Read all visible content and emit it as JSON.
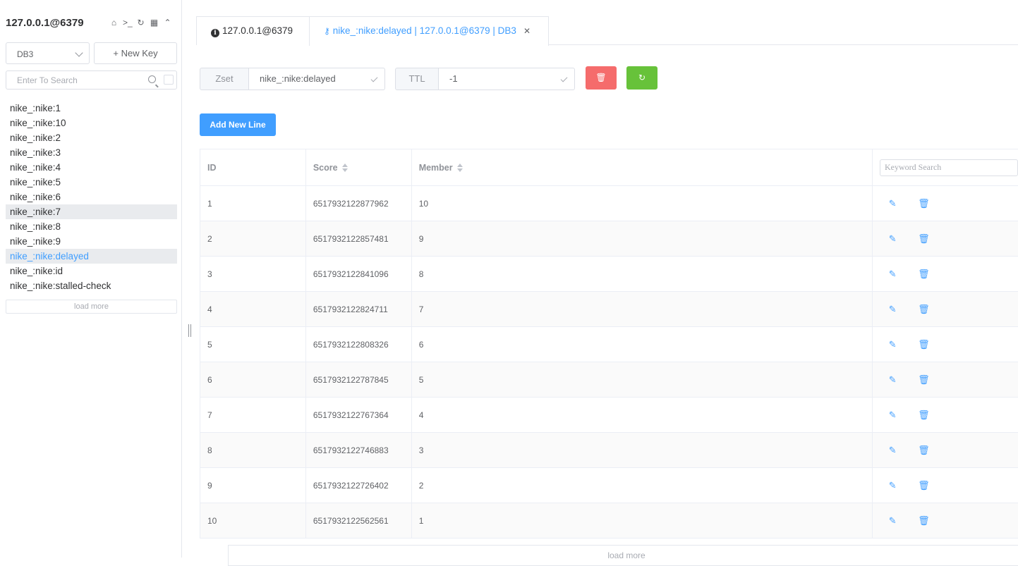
{
  "sidebar": {
    "connection_title": "127.0.0.1@6379",
    "icons": [
      "home-icon",
      "terminal-icon",
      "refresh-icon",
      "grid-icon",
      "chevron-up-icon"
    ],
    "db_select": "DB3",
    "new_key_label": "New Key",
    "search_placeholder": "Enter To Search",
    "keys": [
      "nike_:nike:1",
      "nike_:nike:10",
      "nike_:nike:2",
      "nike_:nike:3",
      "nike_:nike:4",
      "nike_:nike:5",
      "nike_:nike:6",
      "nike_:nike:7",
      "nike_:nike:8",
      "nike_:nike:9",
      "nike_:nike:delayed",
      "nike_:nike:id",
      "nike_:nike:stalled-check"
    ],
    "active_key_index": 10,
    "hover_key_index": 7,
    "load_more_label": "load more"
  },
  "tabs": [
    {
      "label": "127.0.0.1@6379",
      "icon": "info-icon"
    },
    {
      "label": "nike_:nike:delayed | 127.0.0.1@6379 | DB3",
      "icon": "key-icon",
      "active": true
    }
  ],
  "key_detail": {
    "type_label": "Zset",
    "key_name": "nike_:nike:delayed",
    "ttl_label": "TTL",
    "ttl_value": "-1",
    "add_line_label": "Add New Line",
    "colors": {
      "delete": "#f56c6c",
      "refresh": "#67c23a",
      "primary": "#409eff"
    }
  },
  "table": {
    "headers": {
      "id": "ID",
      "score": "Score",
      "member": "Member"
    },
    "keyword_placeholder": "Keyword Search",
    "rows": [
      {
        "id": "1",
        "score": "6517932122877962",
        "member": "10"
      },
      {
        "id": "2",
        "score": "6517932122857481",
        "member": "9"
      },
      {
        "id": "3",
        "score": "6517932122841096",
        "member": "8"
      },
      {
        "id": "4",
        "score": "6517932122824711",
        "member": "7"
      },
      {
        "id": "5",
        "score": "6517932122808326",
        "member": "6"
      },
      {
        "id": "6",
        "score": "6517932122787845",
        "member": "5"
      },
      {
        "id": "7",
        "score": "6517932122767364",
        "member": "4"
      },
      {
        "id": "8",
        "score": "6517932122746883",
        "member": "3"
      },
      {
        "id": "9",
        "score": "6517932122726402",
        "member": "2"
      },
      {
        "id": "10",
        "score": "6517932122562561",
        "member": "1"
      }
    ],
    "load_more_label": "load more"
  }
}
